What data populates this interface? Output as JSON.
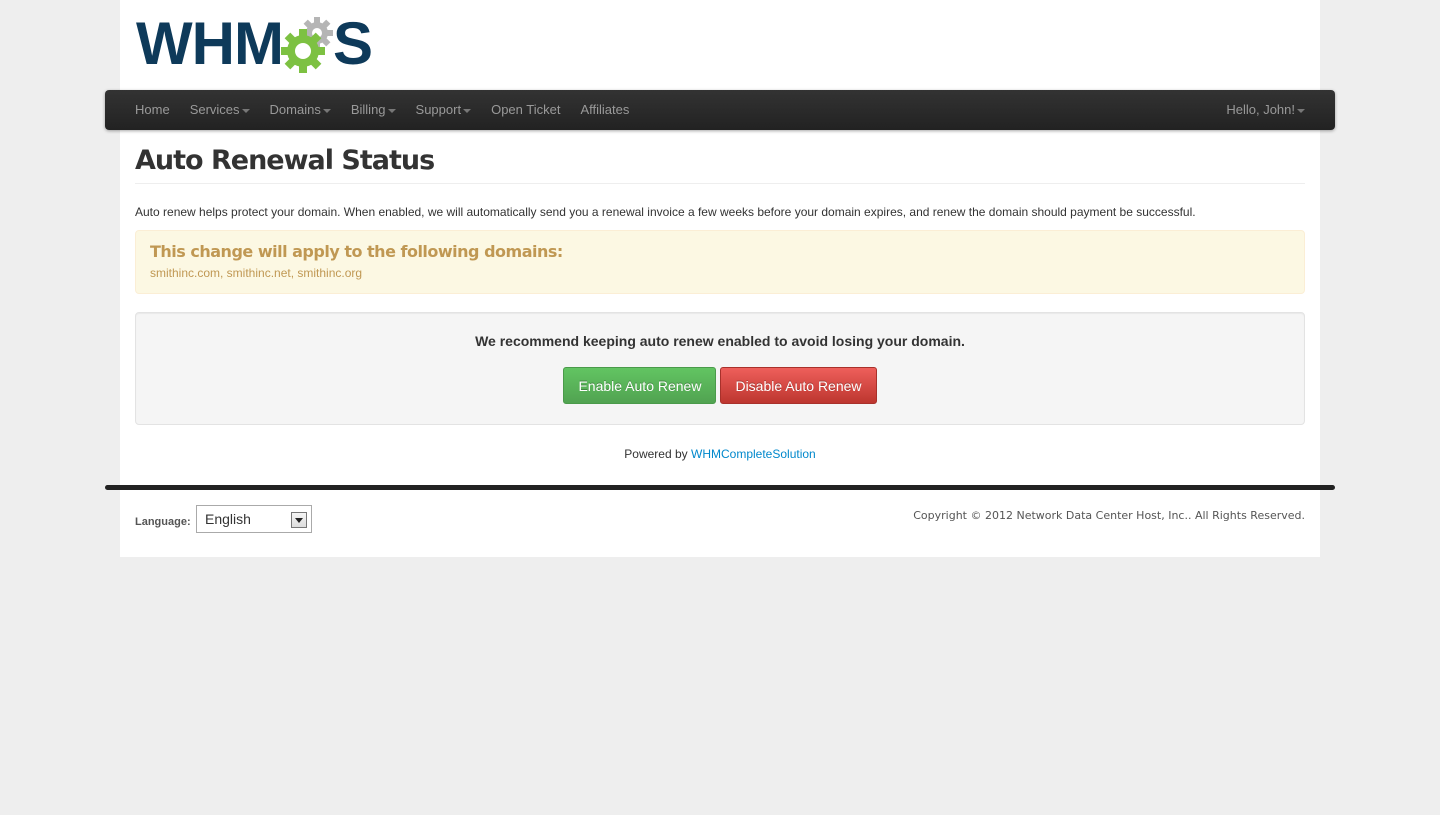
{
  "header": {
    "logo_left": "WHM",
    "logo_right": "S"
  },
  "nav": {
    "items": [
      {
        "label": "Home",
        "dropdown": false
      },
      {
        "label": "Services",
        "dropdown": true
      },
      {
        "label": "Domains",
        "dropdown": true
      },
      {
        "label": "Billing",
        "dropdown": true
      },
      {
        "label": "Support",
        "dropdown": true
      },
      {
        "label": "Open Ticket",
        "dropdown": false
      },
      {
        "label": "Affiliates",
        "dropdown": false
      }
    ],
    "user_greeting": "Hello, John!"
  },
  "main": {
    "title": "Auto Renewal Status",
    "intro": "Auto renew helps protect your domain. When enabled, we will automatically send you a renewal invoice a few weeks before your domain expires, and renew the domain should payment be successful.",
    "alert_heading": "This change will apply to the following domains:",
    "alert_domains": "smithinc.com, smithinc.net, smithinc.org",
    "recommendation": "We recommend keeping auto renew enabled to avoid losing your domain.",
    "enable_button": "Enable Auto Renew",
    "disable_button": "Disable Auto Renew",
    "powered_by_prefix": "Powered by",
    "powered_by_link": "WHMCompleteSolution"
  },
  "footer": {
    "language_label": "Language:",
    "language_value": "English",
    "copyright": "Copyright © 2012 Network Data Center Host, Inc.. All Rights Reserved."
  },
  "colors": {
    "logo_navy": "#0e3a5a",
    "logo_gear_green": "#7dc142",
    "logo_gear_grey": "#aaaaaa",
    "navbar": "#222222",
    "success": "#51a351",
    "danger": "#bd362f",
    "alert_text": "#c09853",
    "link": "#0088cc"
  }
}
